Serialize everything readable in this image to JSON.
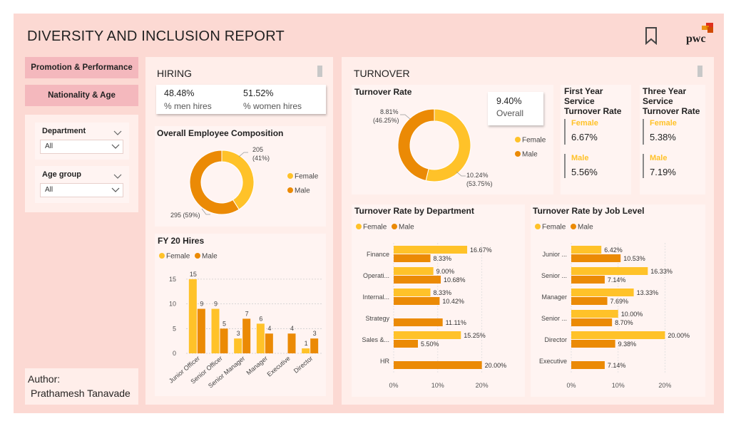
{
  "header": {
    "title": "DIVERSITY AND INCLUSION REPORT",
    "logo_text": "pwc"
  },
  "nav": {
    "promotion_label": "Promotion & Performance",
    "nationality_label": "Nationality & Age"
  },
  "filters": {
    "department": {
      "label": "Department",
      "value": "All"
    },
    "age_group": {
      "label": "Age group",
      "value": "All"
    }
  },
  "author": {
    "label": "Author:",
    "name": "Prathamesh Tanavade"
  },
  "hiring": {
    "title": "HIRING",
    "men_value": "48.48%",
    "men_label": "% men hires",
    "women_value": "51.52%",
    "women_label": "% women hires"
  },
  "turnover": {
    "title": "TURNOVER",
    "overall_value": "9.40%",
    "overall_label": "Overall",
    "first_year": {
      "title_l1": "First Year",
      "title_l2": "Service",
      "title_l3": "Turnover Rate",
      "female_label": "Female",
      "female_value": "6.67%",
      "male_label": "Male",
      "male_value": "5.56%"
    },
    "three_year": {
      "title_l1": "Three Year",
      "title_l2": "Service",
      "title_l3": "Turnover Rate",
      "female_label": "Female",
      "female_value": "5.38%",
      "male_label": "Male",
      "male_value": "7.19%"
    }
  },
  "colors": {
    "female": "#ffc229",
    "male": "#eb8a05",
    "page_bg": "#fcd9d3",
    "nav_button": "#f4b8bd"
  },
  "chart_data": [
    {
      "id": "composition",
      "type": "pie",
      "title": "Overall Employee Composition",
      "labels": [
        "Female",
        "Male"
      ],
      "values": [
        205,
        295
      ],
      "data_labels": [
        "205",
        "(41%)",
        "295 (59%)"
      ],
      "legend": "right"
    },
    {
      "id": "turnover_rate",
      "type": "pie",
      "title": "Turnover Rate",
      "labels": [
        "Female",
        "Male"
      ],
      "values": [
        53.75,
        46.25
      ],
      "data_labels": [
        "10.24%",
        "(53.75%)",
        "8.81%",
        "(46.25%)"
      ],
      "legend": "right"
    },
    {
      "id": "fy20_hires",
      "type": "bar",
      "title": "FY 20 Hires",
      "categories": [
        "Junior Officer",
        "Senior Officer",
        "Senior Manager",
        "Manager",
        "Executive",
        "Director"
      ],
      "series": [
        {
          "name": "Female",
          "values": [
            15,
            9,
            3,
            6,
            null,
            1
          ]
        },
        {
          "name": "Male",
          "values": [
            9,
            5,
            7,
            4,
            4,
            3
          ]
        }
      ],
      "yticks": [
        "0",
        "5",
        "10",
        "15"
      ],
      "ylim": [
        0,
        17
      ],
      "grid": true,
      "legend": "top-left"
    },
    {
      "id": "turnover_dept",
      "type": "bar",
      "orientation": "horizontal",
      "title": "Turnover Rate by Department",
      "categories": [
        "Finance",
        "Operati...",
        "Internal...",
        "Strategy",
        "Sales &...",
        "HR"
      ],
      "series": [
        {
          "name": "Female",
          "values": [
            16.67,
            9.0,
            8.33,
            null,
            15.25,
            null
          ],
          "labels": [
            "16.67%",
            "9.00%",
            "8.33%",
            "",
            "15.25%",
            ""
          ]
        },
        {
          "name": "Male",
          "values": [
            8.33,
            10.68,
            10.42,
            11.11,
            5.5,
            20.0
          ],
          "labels": [
            "8.33%",
            "10.68%",
            "10.42%",
            "11.11%",
            "5.50%",
            "20.00%"
          ]
        }
      ],
      "xticks": [
        "0%",
        "10%",
        "20%"
      ],
      "xlim": [
        0,
        22
      ],
      "legend": "top-left"
    },
    {
      "id": "turnover_level",
      "type": "bar",
      "orientation": "horizontal",
      "title": "Turnover Rate by Job Level",
      "categories": [
        "Junior ...",
        "Senior ...",
        "Manager",
        "Senior ...",
        "Director",
        "Executive"
      ],
      "series": [
        {
          "name": "Female",
          "values": [
            6.42,
            16.33,
            13.33,
            10.0,
            20.0,
            null
          ],
          "labels": [
            "6.42%",
            "16.33%",
            "13.33%",
            "10.00%",
            "20.00%",
            ""
          ]
        },
        {
          "name": "Male",
          "values": [
            10.53,
            7.14,
            7.69,
            8.7,
            9.38,
            7.14
          ],
          "labels": [
            "10.53%",
            "7.14%",
            "7.69%",
            "8.70%",
            "9.38%",
            "7.14%"
          ]
        }
      ],
      "xticks": [
        "0%",
        "10%",
        "20%"
      ],
      "xlim": [
        0,
        21
      ],
      "legend": "top-left"
    }
  ]
}
